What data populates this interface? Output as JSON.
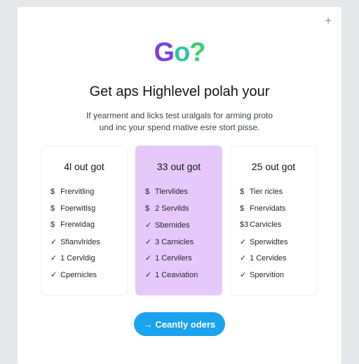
{
  "colors": {
    "logo_g": "#7b3fe4",
    "logo_o": "#2ec4a8",
    "logo_q": "#34d26b",
    "highlight_plan_bg": "#e6c8fb",
    "cta_bg": "#1aa3ee"
  },
  "header": {
    "plus_icon": "+",
    "logo": {
      "g": "G",
      "o": "o",
      "q": "?"
    },
    "headline": "Get aps Highlevel polah your",
    "subtext_line1": "If yearment and licks test uralgals for arming proto",
    "subtext_line2": "und inc your spend rnative esre stort pisse."
  },
  "plans": [
    {
      "title": "4l out got",
      "features": [
        {
          "mark": "$",
          "label": "Frervitling"
        },
        {
          "mark": "$",
          "label": "Foerwitlsg"
        },
        {
          "mark": "$",
          "label": "Frerwidag"
        },
        {
          "mark": "✓",
          "label": "Sfianvlrides"
        },
        {
          "mark": "✓",
          "label": "1 Cervldig"
        },
        {
          "mark": "✓",
          "label": "Cpernicles"
        }
      ]
    },
    {
      "title": "33 out got",
      "highlighted": true,
      "features": [
        {
          "mark": "$",
          "label": "Tlervlides"
        },
        {
          "mark": "$",
          "label": "2 Servilds"
        },
        {
          "mark": "✓",
          "label": "Sbernides"
        },
        {
          "mark": "✓",
          "label": "3 Carnicles"
        },
        {
          "mark": "✓",
          "label": "1 Cervilers"
        },
        {
          "mark": "✓",
          "label": "1 Ceaviation"
        }
      ]
    },
    {
      "title": "25 out got",
      "features": [
        {
          "mark": "$",
          "label": "Tier ricles"
        },
        {
          "mark": "$",
          "label": "Fnervidats"
        },
        {
          "mark": "$3",
          "label": "Carvicles"
        },
        {
          "mark": "✓",
          "label": "Sperwidtes"
        },
        {
          "mark": "✓",
          "label": "1 Cervides"
        },
        {
          "mark": "✓",
          "label": "Spervition"
        }
      ]
    }
  ],
  "cta": {
    "arrow": "→",
    "label": "Ceantly oders"
  }
}
